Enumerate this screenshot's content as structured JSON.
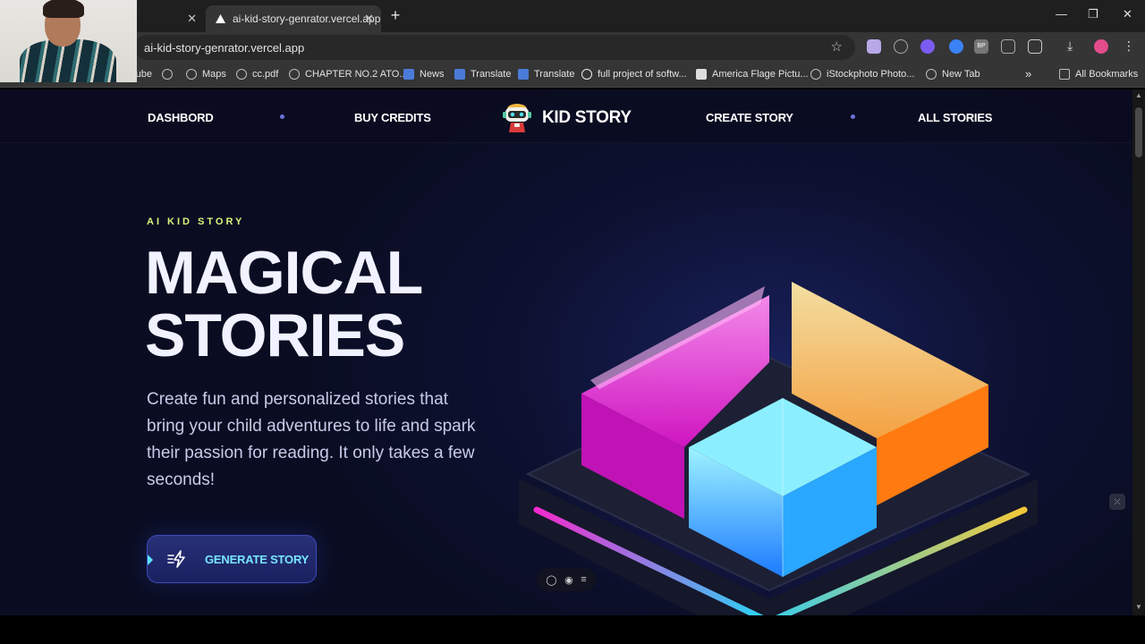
{
  "browser": {
    "tabs": [
      {
        "title": "",
        "active": false
      },
      {
        "title": "ai-kid-story-genrator.vercel.app",
        "active": true
      }
    ],
    "address": "ai-kid-story-genrator.vercel.app",
    "bookmarks": [
      {
        "label": "Youtube"
      },
      {
        "label": ""
      },
      {
        "label": "Maps"
      },
      {
        "label": "cc.pdf"
      },
      {
        "label": "CHAPTER NO.2 ATO..."
      },
      {
        "label": "News"
      },
      {
        "label": "Translate"
      },
      {
        "label": "Translate"
      },
      {
        "label": "full project of softw..."
      },
      {
        "label": "America Flage Pictu..."
      },
      {
        "label": "iStockphoto Photo..."
      },
      {
        "label": "New Tab"
      }
    ],
    "all_bookmarks": "All Bookmarks",
    "overflow": "»"
  },
  "nav": {
    "dashboard": "DASHBORD",
    "buy_credits": "BUY CREDITS",
    "brand": "KID STORY",
    "create_story": "CREATE STORY",
    "all_stories": "ALL STORIES"
  },
  "hero": {
    "eyebrow": "AI KID STORY",
    "title_line1": "MAGICAL",
    "title_line2": "STORIES",
    "description": "Create fun and personalized stories that bring your child adventures to life and spark their passion for reading. It only takes a few seconds!",
    "cta": "GENERATE STORY"
  },
  "colors": {
    "accent": "#77e6ff",
    "eyebrow": "#d7f57a",
    "background": "#0d1131"
  },
  "icons": {
    "cta": "bolt-icon",
    "brand": "robot-logo-icon"
  }
}
